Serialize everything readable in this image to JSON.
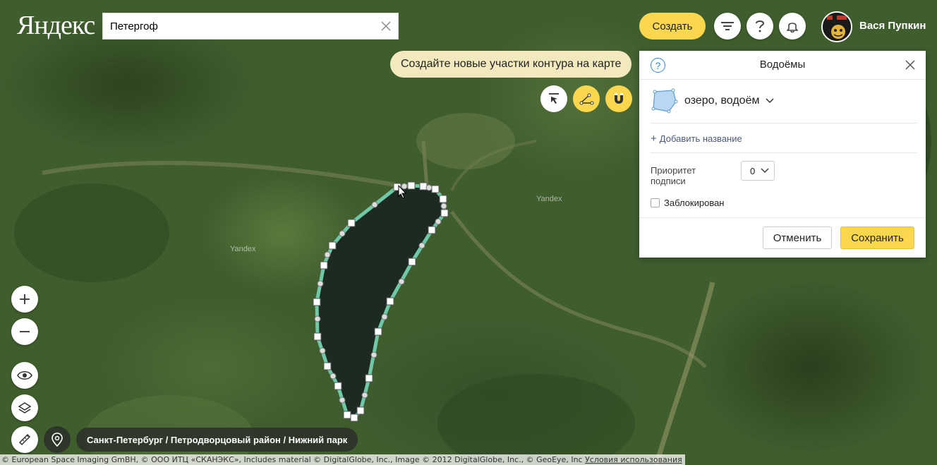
{
  "app": {
    "logo": "Яндекс"
  },
  "header": {
    "search_value": "Петергоф",
    "create_label": "Создать",
    "user_name": "Вася Пупкин"
  },
  "hint": {
    "text": "Создайте новые участки контура на карте"
  },
  "panel": {
    "title": "Водоёмы",
    "help_symbol": "?",
    "object_type": "озеро, водоём",
    "add_name": "Добавить название",
    "priority_label": "Приоритет подписи",
    "priority_value": "0",
    "locked_label": "Заблокирован",
    "cancel_label": "Отменить",
    "save_label": "Сохранить"
  },
  "map": {
    "watermarks": [
      "Yandex",
      "Yandex"
    ],
    "breadcrumb": "Санкт-Петербург / Петродворцовый район / Нижний парк",
    "copyright": "© European Space Imaging GmBH, © ООО ИТЦ «СКАНЭКС», Includes material © DigitalGlobe, Inc., Image © 2012 DigitalGlobe, Inc., © GeoEye, Inc",
    "terms_link": "Условия использования"
  },
  "colors": {
    "accent": "#fad74d",
    "contour": "#6fc9a8",
    "lake_fill": "#1c2a22"
  }
}
